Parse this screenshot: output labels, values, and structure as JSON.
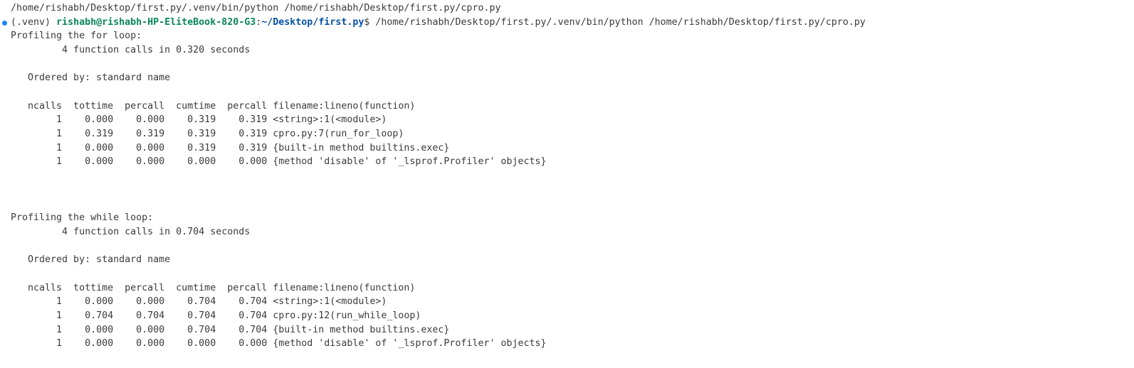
{
  "terminal": {
    "echo_command": "/home/rishabh/Desktop/first.py/.venv/bin/python /home/rishabh/Desktop/first.py/cpro.py",
    "prompt": {
      "venv": "(.venv) ",
      "user_host": "rishabh@rishabh-HP-EliteBook-820-G3",
      "colon": ":",
      "path": "~/Desktop/first.py",
      "dollar": "$ ",
      "command": "/home/rishabh/Desktop/first.py/.venv/bin/python /home/rishabh/Desktop/first.py/cpro.py"
    },
    "sections": [
      {
        "heading": "Profiling the for loop:",
        "summary": "         4 function calls in 0.320 seconds",
        "ordered_by": "   Ordered by: standard name",
        "header": "   ncalls  tottime  percall  cumtime  percall filename:lineno(function)",
        "rows": [
          "        1    0.000    0.000    0.319    0.319 <string>:1(<module>)",
          "        1    0.319    0.319    0.319    0.319 cpro.py:7(run_for_loop)",
          "        1    0.000    0.000    0.319    0.319 {built-in method builtins.exec}",
          "        1    0.000    0.000    0.000    0.000 {method 'disable' of '_lsprof.Profiler' objects}"
        ]
      },
      {
        "heading": "Profiling the while loop:",
        "summary": "         4 function calls in 0.704 seconds",
        "ordered_by": "   Ordered by: standard name",
        "header": "   ncalls  tottime  percall  cumtime  percall filename:lineno(function)",
        "rows": [
          "        1    0.000    0.000    0.704    0.704 <string>:1(<module>)",
          "        1    0.704    0.704    0.704    0.704 cpro.py:12(run_while_loop)",
          "        1    0.000    0.000    0.704    0.704 {built-in method builtins.exec}",
          "        1    0.000    0.000    0.000    0.000 {method 'disable' of '_lsprof.Profiler' objects}"
        ]
      }
    ],
    "colors": {
      "background": "#ffffff",
      "text": "#3b3b3b",
      "user_host": "#098658",
      "path": "#0451a5",
      "decoration": "#1a85ff"
    }
  }
}
